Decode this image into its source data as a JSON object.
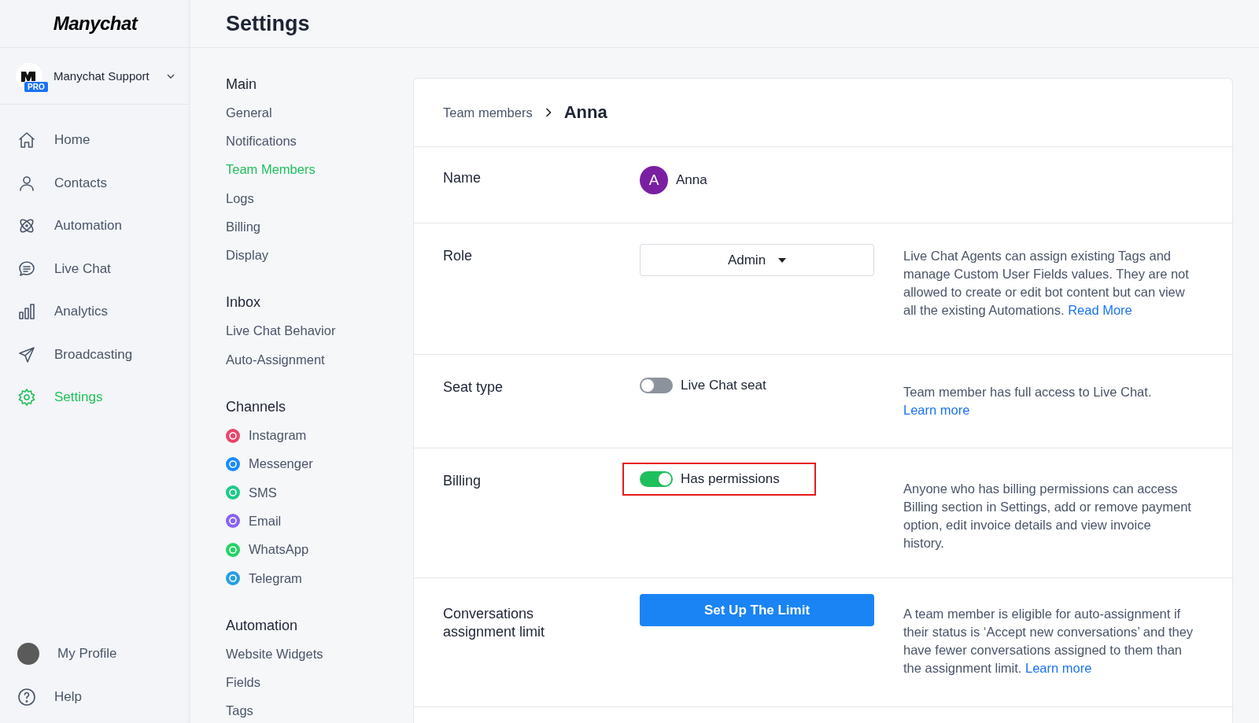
{
  "sidebar": {
    "logo": "Manychat",
    "account": {
      "name": "Manychat Support",
      "badge": "PRO"
    },
    "items": [
      {
        "label": "Home",
        "kind": "home",
        "selected": false
      },
      {
        "label": "Contacts",
        "kind": "person",
        "selected": false
      },
      {
        "label": "Automation",
        "kind": "atom",
        "selected": false
      },
      {
        "label": "Live Chat",
        "kind": "chat",
        "selected": false
      },
      {
        "label": "Analytics",
        "kind": "bars",
        "selected": false
      },
      {
        "label": "Broadcasting",
        "kind": "send",
        "selected": false
      },
      {
        "label": "Settings",
        "kind": "gear",
        "selected": true
      }
    ],
    "bottom": [
      {
        "label": "My Profile",
        "kind": "avatar"
      },
      {
        "label": "Help",
        "kind": "help"
      }
    ]
  },
  "header": {
    "title": "Settings"
  },
  "settings_nav": [
    {
      "heading": "Main",
      "items": [
        {
          "label": "General",
          "selected": false
        },
        {
          "label": "Notifications",
          "selected": false
        },
        {
          "label": "Team Members",
          "selected": true
        },
        {
          "label": "Logs",
          "selected": false
        },
        {
          "label": "Billing",
          "selected": false
        },
        {
          "label": "Display",
          "selected": false
        }
      ]
    },
    {
      "heading": "Inbox",
      "items": [
        {
          "label": "Live Chat Behavior",
          "selected": false
        },
        {
          "label": "Auto-Assignment",
          "selected": false
        }
      ]
    },
    {
      "heading": "Channels",
      "items": [
        {
          "label": "Instagram",
          "selected": false,
          "color": "#e8456b"
        },
        {
          "label": "Messenger",
          "selected": false,
          "color": "#1a8cff"
        },
        {
          "label": "SMS",
          "selected": false,
          "color": "#1fc98a"
        },
        {
          "label": "Email",
          "selected": false,
          "color": "#8a63f5"
        },
        {
          "label": "WhatsApp",
          "selected": false,
          "color": "#25d366"
        },
        {
          "label": "Telegram",
          "selected": false,
          "color": "#2a9de3"
        }
      ]
    },
    {
      "heading": "Automation",
      "items": [
        {
          "label": "Website Widgets",
          "selected": false
        },
        {
          "label": "Fields",
          "selected": false
        },
        {
          "label": "Tags",
          "selected": false
        }
      ]
    }
  ],
  "breadcrumb": {
    "parent": "Team members",
    "current": "Anna"
  },
  "rows": [
    {
      "label": "Name",
      "kind": "user",
      "initial": "A",
      "value": "Anna"
    },
    {
      "label": "Role",
      "kind": "dropdown",
      "value": "Admin",
      "description": "Live Chat Agents can assign existing Tags and manage Custom User Fields values. They are not allowed to create or edit bot content but can view all the existing Automations.",
      "link": "Read More"
    },
    {
      "label": "Seat type",
      "kind": "toggle",
      "on": false,
      "highlighted": false,
      "value": "Live Chat seat",
      "description": "Team member has full access to Live Chat.",
      "link": "Learn more"
    },
    {
      "label": "Billing",
      "kind": "toggle",
      "on": true,
      "highlighted": true,
      "value": "Has permissions",
      "description": "Anyone who has billing permissions can access Billing section in Settings, add or remove payment option, edit invoice details and view invoice history."
    },
    {
      "label": "Conversations assignment limit",
      "kind": "button",
      "value": "Set Up The Limit",
      "description": "A team member is eligible for auto-assignment if their status is ‘Accept new conversations’ and they have fewer conversations assigned to them than the assignment limit.",
      "link": "Learn more"
    }
  ]
}
